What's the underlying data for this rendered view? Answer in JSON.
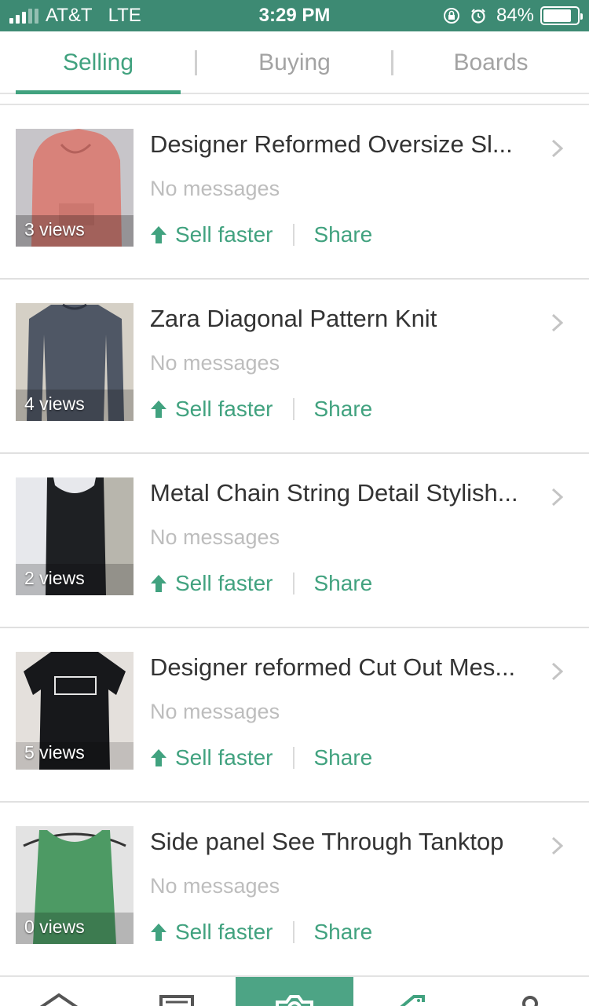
{
  "status_bar": {
    "carrier": "AT&T",
    "network": "LTE",
    "time": "3:29 PM",
    "battery_percent": "84%",
    "battery_level": 0.84,
    "icons": [
      "signal-icon",
      "rotation-lock-icon",
      "alarm-icon",
      "battery-icon"
    ]
  },
  "tabs": [
    {
      "label": "Selling",
      "active": true
    },
    {
      "label": "Buying",
      "active": false
    },
    {
      "label": "Boards",
      "active": false
    }
  ],
  "listings": [
    {
      "title": "Designer Reformed Oversize Sl...",
      "messages": "No messages",
      "views": "3 views",
      "sell_faster": "Sell faster",
      "share": "Share",
      "thumb_colors": [
        "#d8827a",
        "#c7c5c9"
      ]
    },
    {
      "title": "Zara Diagonal Pattern Knit",
      "messages": "No messages",
      "views": "4 views",
      "sell_faster": "Sell faster",
      "share": "Share",
      "thumb_colors": [
        "#4f5765",
        "#d5d0c6"
      ]
    },
    {
      "title": "Metal Chain String Detail Stylish...",
      "messages": "No messages",
      "views": "2 views",
      "sell_faster": "Sell faster",
      "share": "Share",
      "thumb_colors": [
        "#1e2023",
        "#e7e8ec"
      ]
    },
    {
      "title": "Designer reformed Cut Out Mes...",
      "messages": "No messages",
      "views": "5 views",
      "sell_faster": "Sell faster",
      "share": "Share",
      "thumb_colors": [
        "#17181b",
        "#e4e0dc"
      ]
    },
    {
      "title": "Side panel See Through Tanktop",
      "messages": "No messages",
      "views": "0 views",
      "sell_faster": "Sell faster",
      "share": "Share",
      "thumb_colors": [
        "#4d9a64",
        "#e3e3e3"
      ]
    }
  ],
  "bottom_nav": [
    {
      "icon": "home-icon"
    },
    {
      "icon": "list-icon"
    },
    {
      "icon": "camera-icon",
      "highlighted": true
    },
    {
      "icon": "tag-icon"
    },
    {
      "icon": "profile-icon"
    }
  ],
  "colors": {
    "accent": "#41a27f",
    "status_bar": "#3d8a73",
    "muted_text": "#bdbdbd",
    "camera_button": "#4da485"
  }
}
